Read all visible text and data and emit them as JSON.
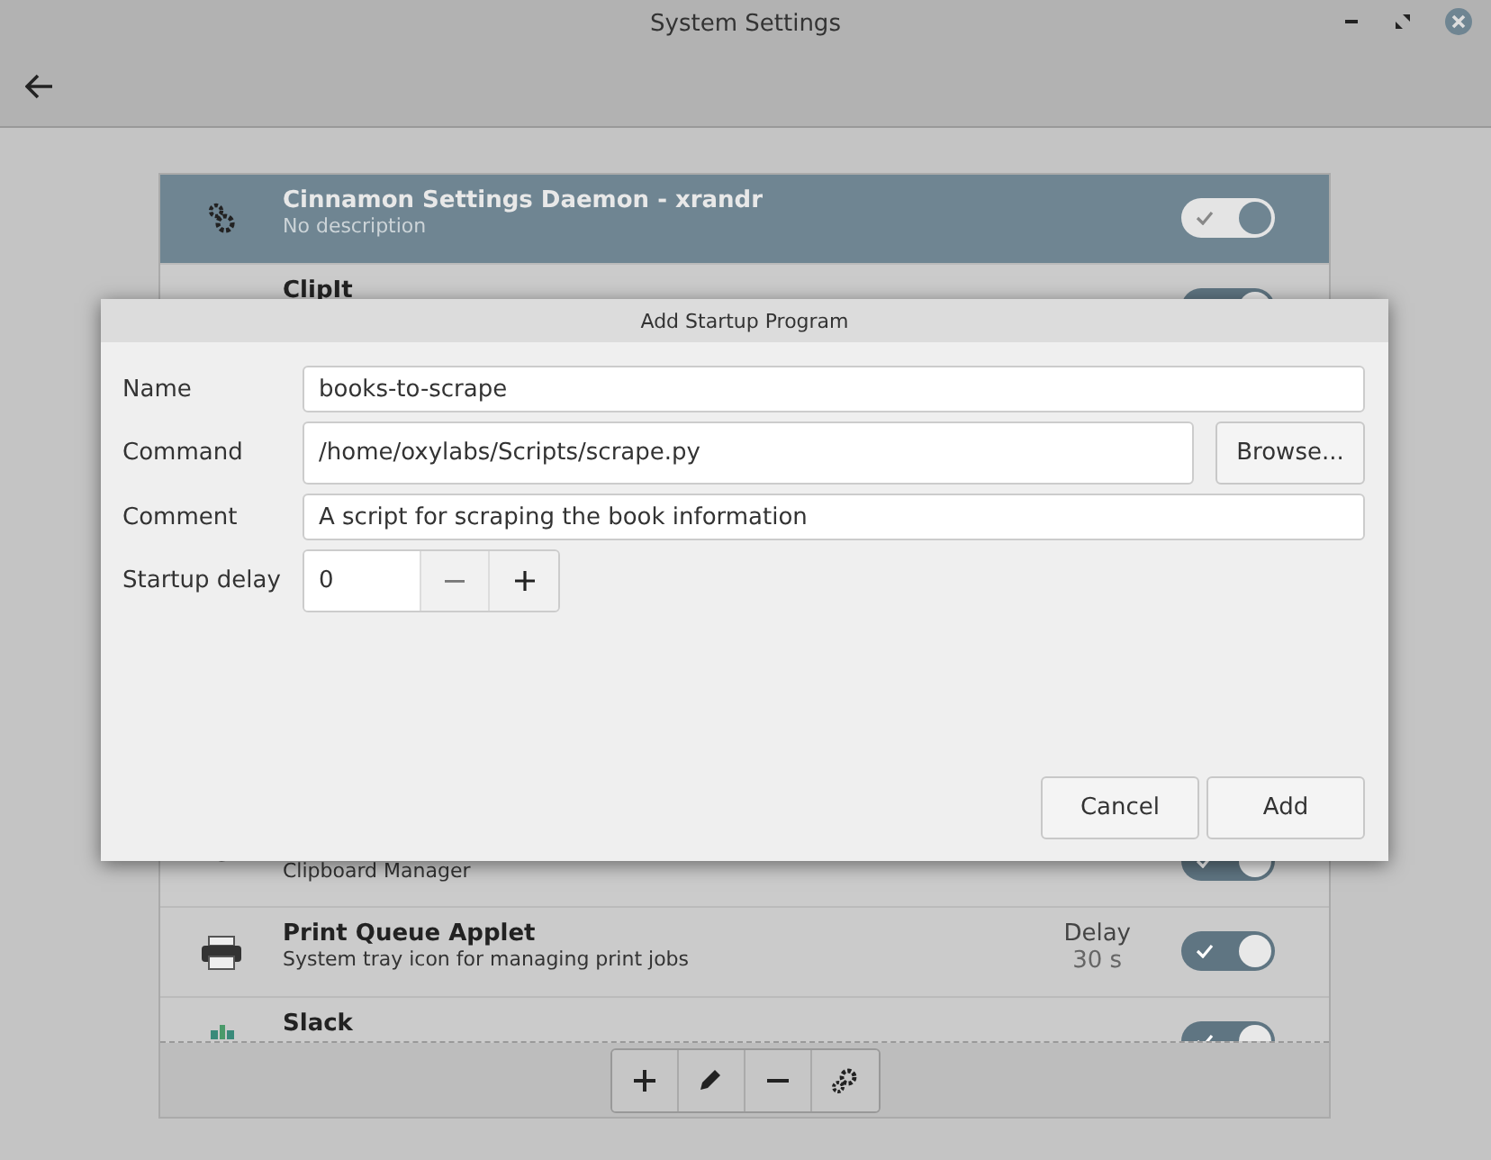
{
  "window": {
    "title": "System Settings"
  },
  "startup_list": {
    "items": [
      {
        "name": "Cinnamon Settings Daemon - xrandr",
        "description": "No description",
        "on": true,
        "selected": true
      },
      {
        "name": "ClipIt",
        "on": true,
        "selected": false
      },
      {
        "description": "Clipboard Manager",
        "on": true,
        "selected": false
      },
      {
        "name": "Print Queue Applet",
        "description": "System tray icon for managing print jobs",
        "delay_label": "Delay",
        "delay_value": "30 s",
        "on": true,
        "selected": false
      },
      {
        "name": "Slack",
        "on": true,
        "selected": false
      }
    ],
    "toolbar": [
      {
        "kind": "add"
      },
      {
        "kind": "edit"
      },
      {
        "kind": "remove"
      },
      {
        "kind": "settings"
      }
    ]
  },
  "dialog": {
    "title": "Add Startup Program",
    "fields": [
      {
        "label": "Name",
        "value": "books-to-scrape"
      },
      {
        "label": "Command",
        "value": "/home/oxylabs/Scripts/scrape.py",
        "button": "Browse..."
      },
      {
        "label": "Comment",
        "value": "A script for scraping the book information"
      }
    ],
    "startup_delay": {
      "label": "Startup delay",
      "value": "0"
    },
    "buttons": [
      "Cancel",
      "Add"
    ]
  }
}
